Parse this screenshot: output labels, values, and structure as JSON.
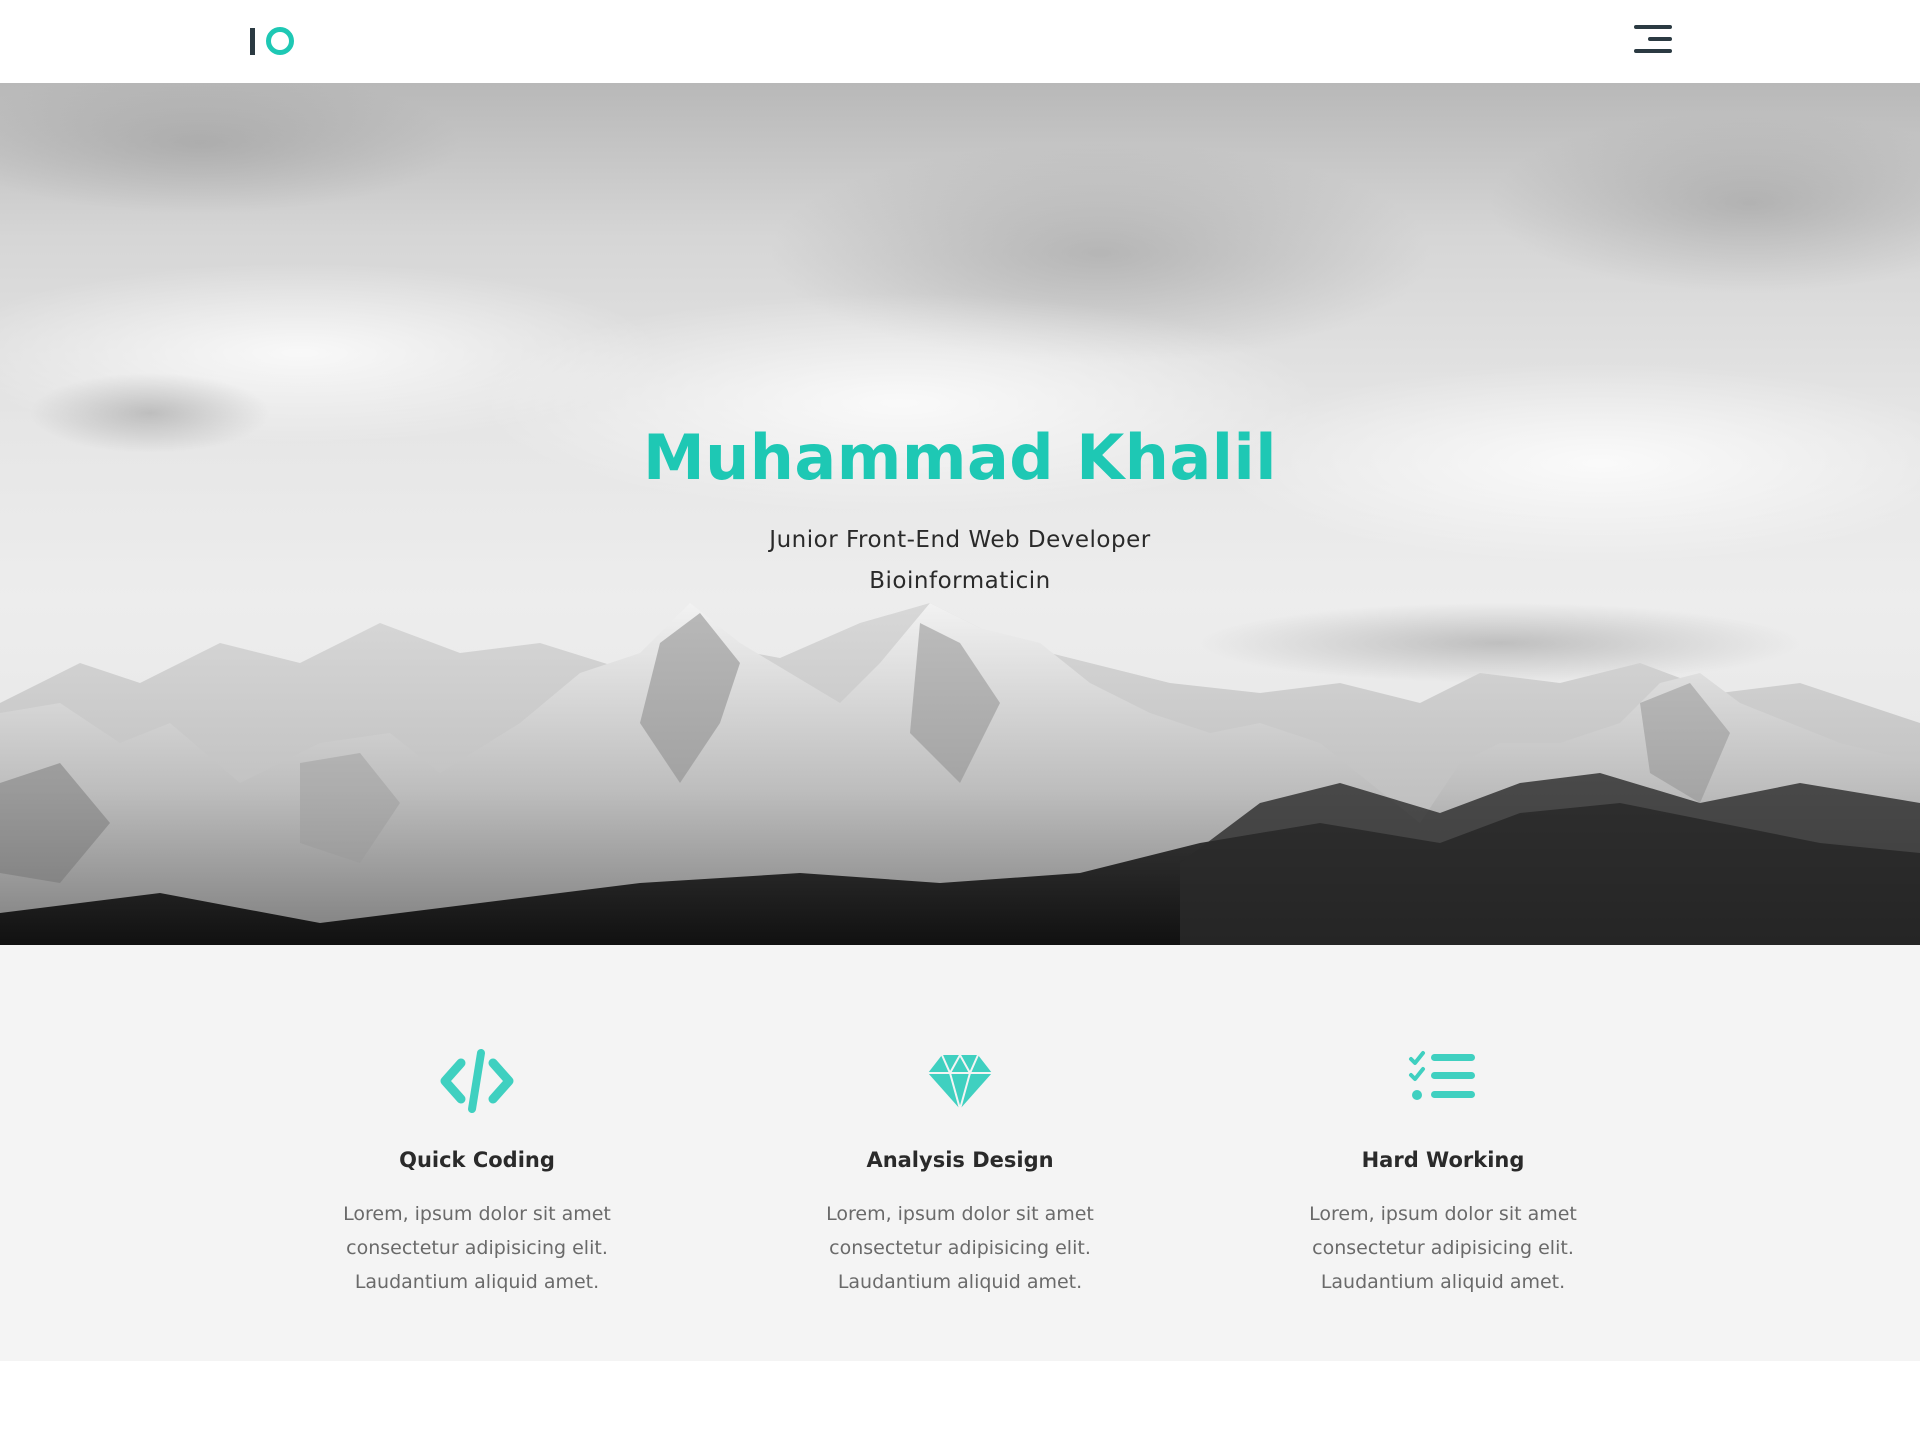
{
  "colors": {
    "accent": "#1ec8b4",
    "icon_accent": "#3fd0c0",
    "dark": "#2b2b2b",
    "muted": "#6a6a6a",
    "features_bg": "#f4f4f4"
  },
  "navbar": {
    "logo_icon": "io-logo-icon",
    "menu_icon": "hamburger-menu-icon"
  },
  "hero": {
    "name": "Muhammad Khalil",
    "subtitle_line1": "Junior Front-End Web Developer",
    "subtitle_line2": "Bioinformaticin"
  },
  "features": [
    {
      "icon": "code-icon",
      "title": "Quick Coding",
      "desc": "Lorem, ipsum dolor sit amet consectetur adipisicing elit. Laudantium aliquid amet."
    },
    {
      "icon": "diamond-icon",
      "title": "Analysis Design",
      "desc": "Lorem, ipsum dolor sit amet consectetur adipisicing elit. Laudantium aliquid amet."
    },
    {
      "icon": "tasks-icon",
      "title": "Hard Working",
      "desc": "Lorem, ipsum dolor sit amet consectetur adipisicing elit. Laudantium aliquid amet."
    }
  ]
}
